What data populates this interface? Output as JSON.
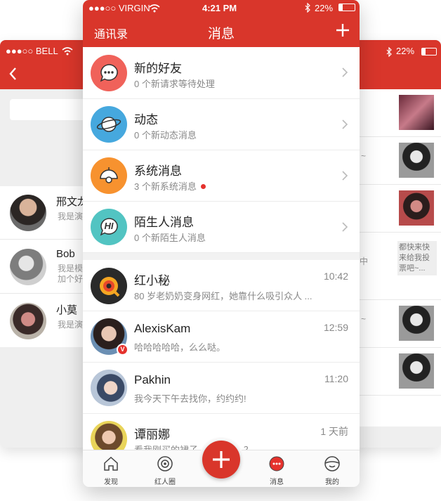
{
  "left_phone": {
    "carrier": "●●●○○ BELL",
    "contacts": [
      {
        "name": "邢文龙",
        "sub": [
          "我是演"
        ]
      },
      {
        "name": "Bob",
        "sub": [
          "我是模",
          "加个好"
        ]
      },
      {
        "name": "小莫",
        "sub": [
          "我是演"
        ]
      }
    ]
  },
  "right_phone": {
    "battery": "22%",
    "peek_texts": [
      "~",
      "中",
      "~"
    ],
    "note": [
      "都快来快",
      "来给我投",
      "票吧~..."
    ]
  },
  "status_bar": {
    "carrier": "●●●○○ VIRGIN",
    "time": "4:21 PM",
    "battery": "22%"
  },
  "nav": {
    "left_label": "通讯录",
    "title": "消息"
  },
  "system_rows": [
    {
      "title": "新的好友",
      "sub": "0 个新请求等待处理",
      "color": "#f0625a",
      "icon": "chat-bubble-icon"
    },
    {
      "title": "动态",
      "sub": "0 个新动态消息",
      "color": "#46a8de",
      "icon": "planet-icon"
    },
    {
      "title": "系统消息",
      "sub": "3 个新系统消息",
      "color": "#f7922f",
      "icon": "bell-icon"
    },
    {
      "title": "陌生人消息",
      "sub": "0 个新陌生人消息",
      "color": "#52c4c2",
      "icon": "hi-bubble-icon",
      "icon_text": "HI"
    }
  ],
  "chats": [
    {
      "name": "红小秘",
      "time": "10:42",
      "preview": "80 岁老奶奶变身网红，她靠什么吸引众人 ..."
    },
    {
      "name": "AlexisKam",
      "time": "12:59",
      "preview": "哈哈哈哈哈，么么哒。",
      "badge": "V"
    },
    {
      "name": "Pakhin",
      "time": "11:20",
      "preview": "我今天下午去找你，约约约!"
    },
    {
      "name": "谭丽娜",
      "time": "1 天前",
      "preview": "看我刚买的裙子，好看吗？？"
    }
  ],
  "tabs": [
    {
      "label": "发现",
      "icon": "home-icon"
    },
    {
      "label": "红人圈",
      "icon": "camera-lens-icon"
    },
    {
      "label": "消息",
      "icon": "message-icon",
      "active": true
    },
    {
      "label": "我的",
      "icon": "profile-icon"
    }
  ],
  "colors": {
    "accent": "#d9362b",
    "text_muted": "#888888"
  }
}
